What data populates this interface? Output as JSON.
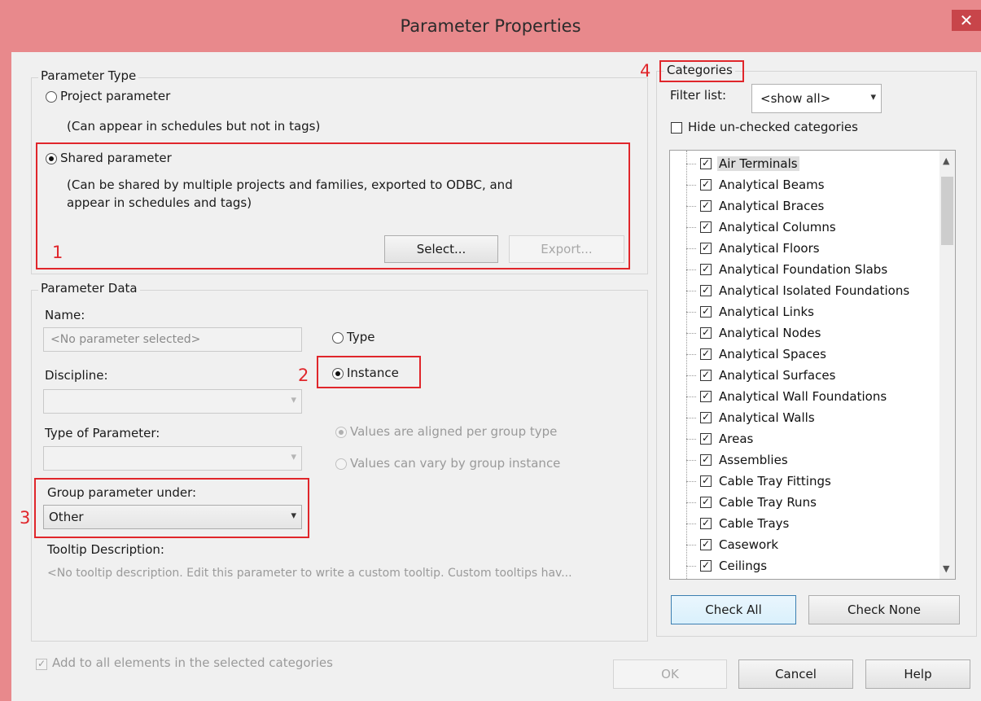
{
  "window": {
    "title": "Parameter Properties",
    "close_glyph": "✕"
  },
  "param_type": {
    "legend": "Parameter Type",
    "project_label": "Project parameter",
    "project_desc": "(Can appear in schedules but not in tags)",
    "shared_label": "Shared parameter",
    "shared_desc_line1": "(Can be shared by multiple projects and families, exported to ODBC, and",
    "shared_desc_line2": "appear in schedules and tags)",
    "select_button": "Select...",
    "export_button": "Export..."
  },
  "param_data": {
    "legend": "Parameter Data",
    "name_label": "Name:",
    "name_value": "<No parameter selected>",
    "type_label": "Type",
    "instance_label": "Instance",
    "discipline_label": "Discipline:",
    "type_of_param_label": "Type of Parameter:",
    "aligned_label": "Values are aligned per group type",
    "vary_label": "Values can vary by group instance",
    "group_label": "Group parameter under:",
    "group_value": "Other",
    "tooltip_label": "Tooltip Description:",
    "tooltip_value": "<No tooltip description. Edit this parameter to write a custom tooltip. Custom tooltips hav..."
  },
  "categories": {
    "legend": "Categories",
    "filter_label": "Filter list:",
    "filter_value": "<show all>",
    "hide_unchecked_label": "Hide un-checked categories",
    "items": [
      "Air Terminals",
      "Analytical Beams",
      "Analytical Braces",
      "Analytical Columns",
      "Analytical Floors",
      "Analytical Foundation Slabs",
      "Analytical Isolated Foundations",
      "Analytical Links",
      "Analytical Nodes",
      "Analytical Spaces",
      "Analytical Surfaces",
      "Analytical Wall Foundations",
      "Analytical Walls",
      "Areas",
      "Assemblies",
      "Cable Tray Fittings",
      "Cable Tray Runs",
      "Cable Trays",
      "Casework",
      "Ceilings"
    ],
    "check_all": "Check All",
    "check_none": "Check None"
  },
  "footer": {
    "add_to_all_label": "Add to all elements in the selected categories",
    "ok": "OK",
    "cancel": "Cancel",
    "help": "Help"
  },
  "annotations": {
    "n1": "1",
    "n2": "2",
    "n3": "3",
    "n4": "4"
  },
  "glyphs": {
    "check": "✓",
    "combo_arrow": "▾",
    "scroll_up": "▲",
    "scroll_down": "▼"
  }
}
